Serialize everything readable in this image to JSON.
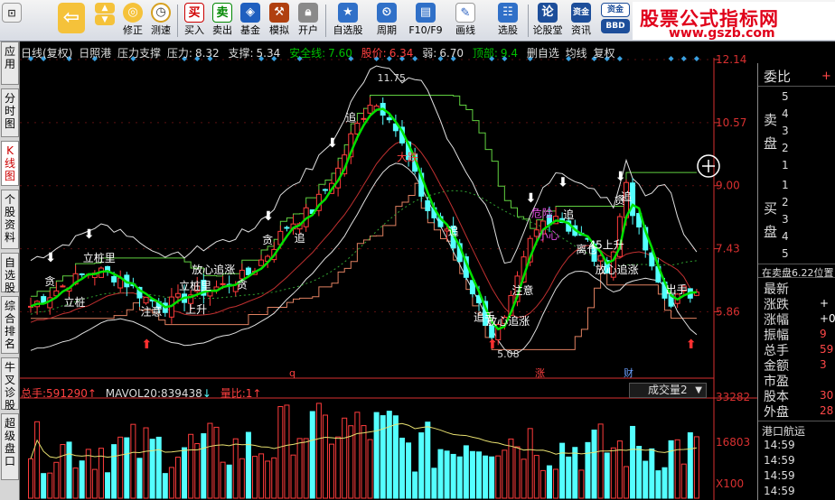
{
  "toolbar": {
    "buttons": [
      {
        "label": "",
        "icon": "back-arrow-icon"
      },
      {
        "label": "修正",
        "icon": "refresh-icon"
      },
      {
        "label": "测速",
        "icon": "clock-icon"
      },
      {
        "label": "买入",
        "icon": "buy-icon",
        "glyph": "买"
      },
      {
        "label": "卖出",
        "icon": "sell-icon",
        "glyph": "卖"
      },
      {
        "label": "基金",
        "icon": "fund-icon"
      },
      {
        "label": "模拟",
        "icon": "hammer-icon"
      },
      {
        "label": "开户",
        "icon": "lock-icon"
      },
      {
        "label": "自选股",
        "icon": "star-icon"
      },
      {
        "label": "周期",
        "icon": "cycle-icon"
      },
      {
        "label": "F10/F9",
        "icon": "f10-icon"
      },
      {
        "label": "画线",
        "icon": "pencil-icon"
      },
      {
        "label": "选股",
        "icon": "pick-icon"
      },
      {
        "label": "论股堂",
        "icon": "forum-icon",
        "glyph": "论"
      },
      {
        "label": "资讯",
        "icon": "news-icon",
        "glyph": "资金"
      },
      {
        "label": "",
        "icon": "bbd-icon",
        "glyph": "BBD"
      }
    ],
    "brand_title": "股票公式指标网",
    "brand_url": "www.gszb.com"
  },
  "left_tabs": [
    "应用",
    "分时图",
    "K线图",
    "个股资料",
    "自选股",
    "综合排名",
    "牛叉诊股",
    "超级盘口"
  ],
  "active_tab": 2,
  "title": {
    "period": "日线(复权)",
    "stock": "日照港",
    "indicator": "压力支撑",
    "pressure_label": "压力:",
    "pressure": "8.32",
    "support_label": "支撑:",
    "support": "5.34",
    "safe_label": "安全线:",
    "safe": "7.60",
    "price_label": "股价:",
    "price": "6.34",
    "weak_label": "弱:",
    "weak": "6.70",
    "top_label": "顶部:",
    "top": "9.4",
    "delete_label": "删自选",
    "ma_label": "均线",
    "fq_label": "复权"
  },
  "colors": {
    "up": "#ff3c3c",
    "down": "#54ffff",
    "green_line": "#00e000",
    "white_line": "#e0e0e0",
    "pressure_line": "#60d040",
    "support_line": "#e08060",
    "axis_red": "#d83030",
    "vol_ma": "#e8e070"
  },
  "chart_data": {
    "type": "candlestick",
    "ylim": [
      4.5,
      12.14
    ],
    "y_ticks": [
      "12.14",
      "10.57",
      "9.00",
      "7.43",
      "5.86"
    ],
    "annotations": {
      "peak": "11.75",
      "low": "5.08"
    },
    "signals": [
      {
        "text": "贪",
        "color": "#ffffff"
      },
      {
        "text": "立桩",
        "color": "#ffffff"
      },
      {
        "text": "立桩里",
        "color": "#ffffff"
      },
      {
        "text": "注意",
        "color": "#ffffff"
      },
      {
        "text": "立桩里",
        "color": "#ffffff"
      },
      {
        "text": "上升",
        "color": "#ffffff"
      },
      {
        "text": "放心追涨",
        "color": "#ffffff"
      },
      {
        "text": "贪",
        "color": "#ffffff"
      },
      {
        "text": "贪",
        "color": "#ffffff"
      },
      {
        "text": "追",
        "color": "#ffffff"
      },
      {
        "text": "追",
        "color": "#ffffff"
      },
      {
        "text": "大跌",
        "color": "#ff4040"
      },
      {
        "text": "追",
        "color": "#ffffff"
      },
      {
        "text": "追手",
        "color": "#ffffff"
      },
      {
        "text": "放心追涨",
        "color": "#ffffff"
      },
      {
        "text": "注意",
        "color": "#ffffff"
      },
      {
        "text": "危险",
        "color": "#e050e0"
      },
      {
        "text": "小心",
        "color": "#e050e0"
      },
      {
        "text": "追",
        "color": "#ffffff"
      },
      {
        "text": "离仓",
        "color": "#ffffff"
      },
      {
        "text": "45上升",
        "color": "#ffffff"
      },
      {
        "text": "放心追涨",
        "color": "#ffffff"
      },
      {
        "text": "贪",
        "color": "#ffffff"
      },
      {
        "text": "追",
        "color": "#ffffff"
      },
      {
        "text": "出手",
        "color": "#ffffff"
      }
    ],
    "bottom_marks": [
      "q",
      "涨",
      "财"
    ]
  },
  "volume": {
    "total_label": "总手:",
    "total": "591290",
    "mavol_label": "MAVOL20:",
    "mavol": "839438",
    "ratio_label": "量比:",
    "ratio": "1",
    "dropdown": "成交量2",
    "y_ticks": [
      "33282",
      "16803",
      "X100"
    ]
  },
  "right_panel": {
    "top": "委比",
    "top_value": "+",
    "sell_label": "卖盘",
    "buy_label": "买盘",
    "sell_levels": [
      "5",
      "4",
      "3",
      "2",
      "1"
    ],
    "buy_levels": [
      "1",
      "2",
      "3",
      "4",
      "5"
    ],
    "bar_text": "在卖盘6.22位置",
    "stats": [
      {
        "label": "最新",
        "value": ""
      },
      {
        "label": "涨跌",
        "value": "+"
      },
      {
        "label": "涨幅",
        "value": "+0"
      },
      {
        "label": "振幅",
        "value": "9"
      },
      {
        "label": "总手",
        "value": "59"
      },
      {
        "label": "金额",
        "value": "3"
      },
      {
        "label": "市盈",
        "value": ""
      },
      {
        "label": "股本",
        "value": "30"
      },
      {
        "label": "外盘",
        "value": "28"
      }
    ],
    "company": "港口航运",
    "times": [
      "14:59",
      "14:59",
      "14:59",
      "14:59"
    ]
  }
}
